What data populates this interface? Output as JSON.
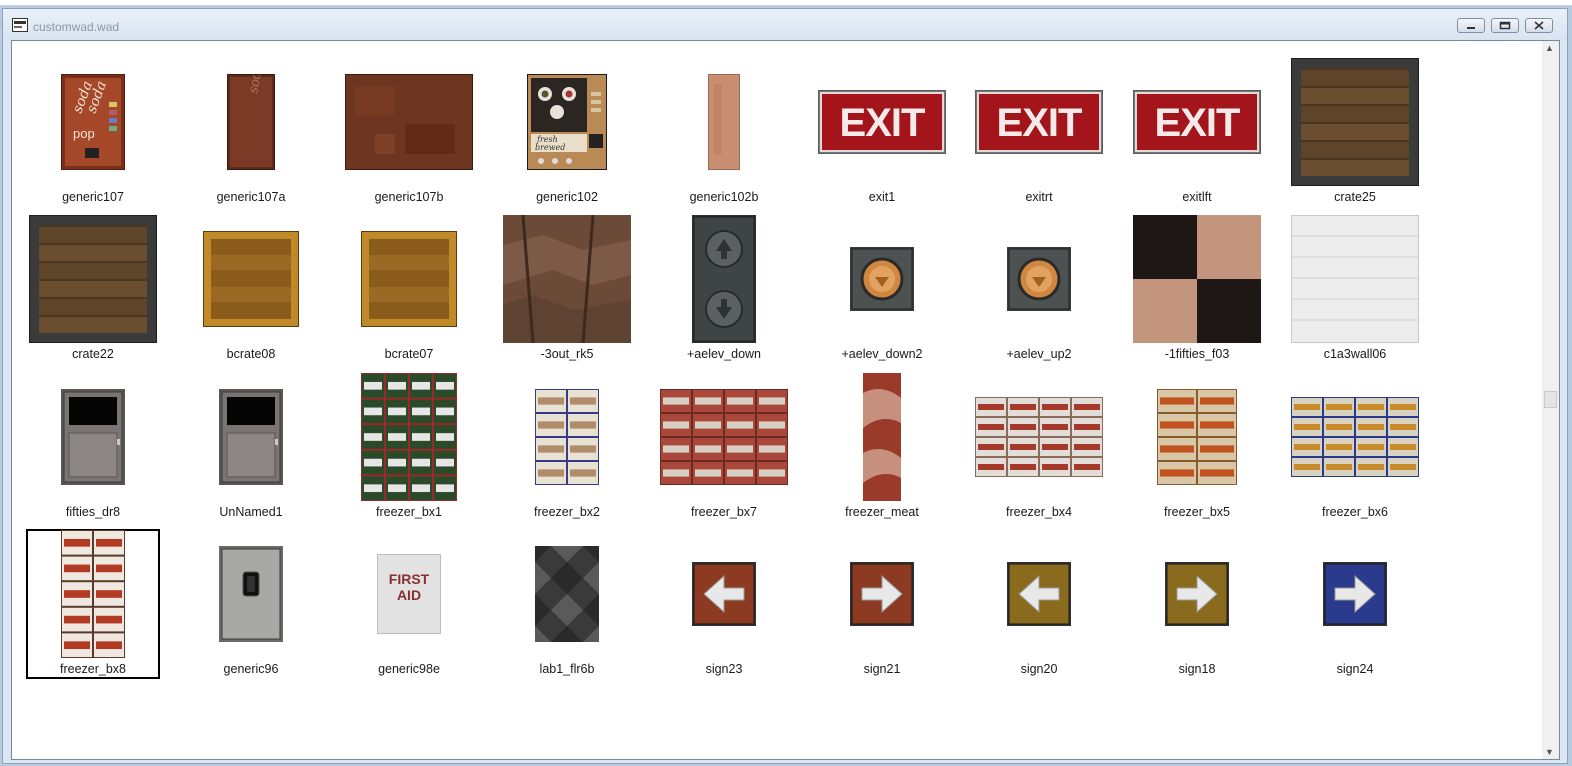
{
  "window": {
    "title": "customwad.wad",
    "icon": "wad-file-icon",
    "controls": [
      "minimize-icon",
      "restore-icon",
      "close-icon"
    ]
  },
  "textures": [
    {
      "name": "generic107",
      "style": "soda-machine",
      "text": "soda soda pop",
      "selected": false
    },
    {
      "name": "generic107a",
      "style": "soda-panel",
      "text": "soda",
      "selected": false
    },
    {
      "name": "generic107b",
      "style": "rust",
      "selected": false
    },
    {
      "name": "generic102",
      "style": "coffee-machine",
      "text": "fresh brewed",
      "selected": false
    },
    {
      "name": "generic102b",
      "style": "tan-strip",
      "selected": false
    },
    {
      "name": "exit1",
      "style": "exit",
      "text": "EXIT",
      "selected": false
    },
    {
      "name": "exitrt",
      "style": "exit",
      "text": "EXIT",
      "selected": false
    },
    {
      "name": "exitlft",
      "style": "exit",
      "text": "EXIT",
      "selected": false
    },
    {
      "name": "crate25",
      "style": "crate-dark",
      "selected": false
    },
    {
      "name": "crate22",
      "style": "crate-dark",
      "selected": false
    },
    {
      "name": "bcrate08",
      "style": "crate-light",
      "selected": false
    },
    {
      "name": "bcrate07",
      "style": "crate-light",
      "selected": false
    },
    {
      "name": "-3out_rk5",
      "style": "rock",
      "selected": false
    },
    {
      "name": "+aelev_down",
      "style": "elev-panel",
      "selected": false
    },
    {
      "name": "+aelev_down2",
      "style": "elev-button",
      "selected": false
    },
    {
      "name": "+aelev_up2",
      "style": "elev-button",
      "selected": false
    },
    {
      "name": "-1fifties_f03",
      "style": "checker-floor",
      "selected": false
    },
    {
      "name": "c1a3wall06",
      "style": "white-wall",
      "selected": false
    },
    {
      "name": "fifties_dr8",
      "style": "door-window",
      "selected": false
    },
    {
      "name": "UnNamed1",
      "style": "door-window",
      "selected": false
    },
    {
      "name": "freezer_bx1",
      "style": "boxes-green",
      "selected": false
    },
    {
      "name": "freezer_bx2",
      "style": "boxes-white",
      "selected": false
    },
    {
      "name": "freezer_bx7",
      "style": "boxes-red",
      "selected": false
    },
    {
      "name": "freezer_meat",
      "style": "meat",
      "selected": false
    },
    {
      "name": "freezer_bx4",
      "style": "boxes-red-white",
      "selected": false
    },
    {
      "name": "freezer_bx5",
      "style": "boxes-cheez",
      "selected": false
    },
    {
      "name": "freezer_bx6",
      "style": "boxes-gold",
      "selected": false
    },
    {
      "name": "freezer_bx8",
      "style": "boxes-carrots",
      "selected": true
    },
    {
      "name": "generic96",
      "style": "metal-door",
      "selected": false
    },
    {
      "name": "generic98e",
      "style": "first-aid",
      "text": "FIRST AID",
      "selected": false
    },
    {
      "name": "lab1_flr6b",
      "style": "diamond-floor",
      "selected": false
    },
    {
      "name": "sign23",
      "style": "arrow-left-red",
      "selected": false
    },
    {
      "name": "sign21",
      "style": "arrow-right-red",
      "selected": false
    },
    {
      "name": "sign20",
      "style": "arrow-left-gold",
      "selected": false
    },
    {
      "name": "sign18",
      "style": "arrow-right-gold",
      "selected": false
    },
    {
      "name": "sign24",
      "style": "arrow-right-blue",
      "selected": false
    }
  ],
  "colors": {
    "exit_red": "#a3151a",
    "crate_brown": "#6b4a2b",
    "sign_red": "#8c3a22",
    "sign_gold": "#8a6a1c",
    "sign_blue": "#2a3a8c"
  }
}
